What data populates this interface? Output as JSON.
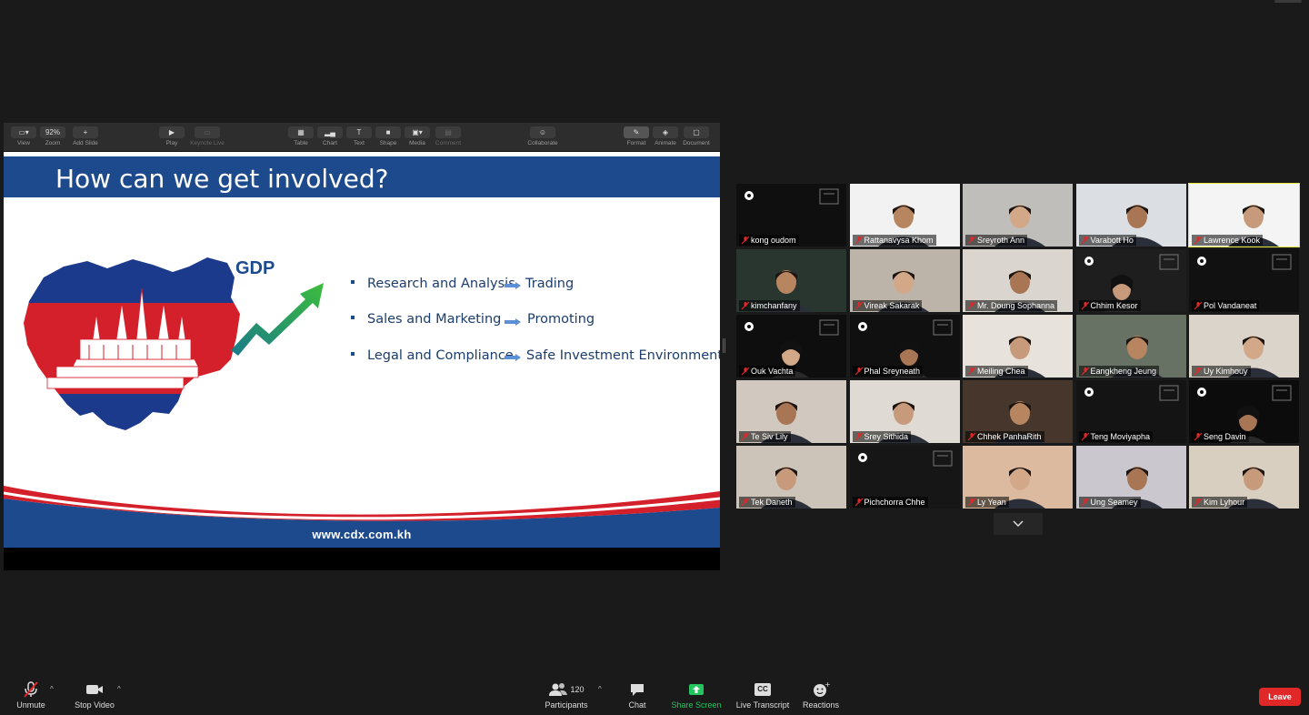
{
  "keynote_toolbar": {
    "items": [
      {
        "label": "View",
        "icon": "view-icon"
      },
      {
        "label": "Zoom",
        "value": "92%"
      },
      {
        "label": "Add Slide",
        "icon": "plus-icon"
      },
      {
        "label": "Play",
        "icon": "play-icon"
      },
      {
        "label": "Keynote Live",
        "icon": "keynote-live-icon"
      },
      {
        "label": "Table",
        "icon": "table-icon"
      },
      {
        "label": "Chart",
        "icon": "chart-icon"
      },
      {
        "label": "Text",
        "icon": "text-icon",
        "glyph": "T"
      },
      {
        "label": "Shape",
        "icon": "shape-icon"
      },
      {
        "label": "Media",
        "icon": "media-icon"
      },
      {
        "label": "Comment",
        "icon": "comment-icon"
      },
      {
        "label": "Collaborate",
        "icon": "collaborate-icon"
      },
      {
        "label": "Format",
        "icon": "format-icon"
      },
      {
        "label": "Animate",
        "icon": "animate-icon"
      },
      {
        "label": "Document",
        "icon": "document-icon"
      }
    ]
  },
  "slide": {
    "title": "How can we get involved?",
    "gdp_label": "GDP",
    "bullets": [
      {
        "left": "Research and Analysis",
        "right": "Trading"
      },
      {
        "left": "Sales and Marketing",
        "right": "Promoting"
      },
      {
        "left": "Legal and Compliance",
        "right": "Safe Investment Environment"
      }
    ],
    "url": "www.cdx.com.kh",
    "colors": {
      "blue": "#1c4a8c",
      "red": "#d4202a",
      "green": "#2ea043"
    }
  },
  "participants": [
    {
      "name": "kong oudom",
      "bg": "#0f0f0f",
      "logo": true,
      "speaking": false
    },
    {
      "name": "Rattanavysa Khom",
      "bg": "#f2f2f2",
      "logo": false,
      "speaking": false
    },
    {
      "name": "Sreyroth Ann",
      "bg": "#bdbab6",
      "logo": false,
      "speaking": false
    },
    {
      "name": "Varabott Ho",
      "bg": "#d9dde2",
      "logo": false,
      "speaking": false
    },
    {
      "name": "Lawrence Kook",
      "bg": "#f4f4f4",
      "logo": false,
      "speaking": true
    },
    {
      "name": "kimchanfany",
      "bg": "#1c2a24",
      "logo": false,
      "speaking": false
    },
    {
      "name": "Vireak Sakarak",
      "bg": "#b8b0a4",
      "logo": false,
      "speaking": false
    },
    {
      "name": "Mr. Doung Sophanna",
      "bg": "#d8d4cc",
      "logo": false,
      "speaking": false
    },
    {
      "name": "Chhim Kesor",
      "bg": "#1e1e1e",
      "logo": true,
      "speaking": false
    },
    {
      "name": "Pol Vandaneat",
      "bg": "#111111",
      "logo": true,
      "speaking": false
    },
    {
      "name": "Ouk Vachta",
      "bg": "#0e0e0e",
      "logo": true,
      "speaking": false
    },
    {
      "name": "Phal Sreyneath",
      "bg": "#101010",
      "logo": true,
      "speaking": false
    },
    {
      "name": "Meiling Chea",
      "bg": "#e6e2da",
      "logo": false,
      "speaking": false
    },
    {
      "name": "Eangkheng Jeung",
      "bg": "#5e6a5c",
      "logo": false,
      "speaking": false
    },
    {
      "name": "Uy Kimhouy",
      "bg": "#d8d2c8",
      "logo": false,
      "speaking": false
    },
    {
      "name": "Te Siv Lily",
      "bg": "#cfc6bb",
      "logo": false,
      "speaking": false
    },
    {
      "name": "Srey Sithida",
      "bg": "#ded9d2",
      "logo": false,
      "speaking": false
    },
    {
      "name": "Chhek PanhaRith",
      "bg": "#3b2a1f",
      "logo": false,
      "speaking": false
    },
    {
      "name": "Teng Moviyapha",
      "bg": "#141414",
      "logo": true,
      "speaking": false
    },
    {
      "name": "Seng Davin",
      "bg": "#0c0c0c",
      "logo": true,
      "speaking": false
    },
    {
      "name": "Tek Daneth",
      "bg": "#c9c0b5",
      "logo": false,
      "speaking": false
    },
    {
      "name": "Pichchorra Chhe",
      "bg": "#161616",
      "logo": true,
      "speaking": false
    },
    {
      "name": "Ly Yean",
      "bg": "#d9b69a",
      "logo": false,
      "speaking": false
    },
    {
      "name": "Ung Seamey",
      "bg": "#c8c4cc",
      "logo": false,
      "speaking": false
    },
    {
      "name": "Kim Lyhour",
      "bg": "#d6cdbd",
      "logo": false,
      "speaking": false
    }
  ],
  "bottom_bar": {
    "unmute": {
      "label": "Unmute",
      "icon": "mic-muted-icon"
    },
    "stop_video": {
      "label": "Stop Video",
      "icon": "video-camera-icon"
    },
    "participants": {
      "label": "Participants",
      "count": "120",
      "icon": "participants-icon"
    },
    "chat": {
      "label": "Chat",
      "icon": "chat-icon"
    },
    "share_screen": {
      "label": "Share Screen",
      "icon": "share-screen-icon",
      "color": "#22c55e"
    },
    "live_transcript": {
      "label": "Live Transcript",
      "icon": "cc-icon",
      "glyph": "CC"
    },
    "reactions": {
      "label": "Reactions",
      "icon": "reactions-icon"
    },
    "leave": {
      "label": "Leave",
      "color": "#e02828"
    }
  }
}
